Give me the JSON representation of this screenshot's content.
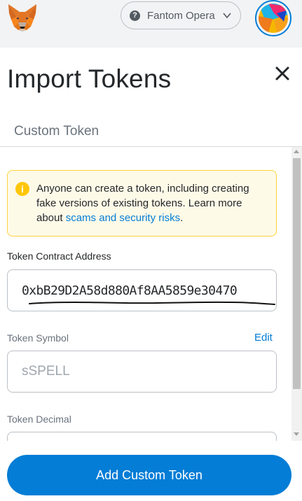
{
  "header": {
    "network_label": "Fantom Opera",
    "network_help_glyph": "?",
    "icons": {
      "logo": "metamask-fox-icon",
      "help": "question-circle-icon",
      "dropdown": "chevron-down-icon",
      "account": "account-avatar-icon",
      "close": "close-icon",
      "warning": "info-warning-icon"
    }
  },
  "page": {
    "title": "Import Tokens",
    "tab_custom_token": "Custom Token"
  },
  "warning": {
    "glyph": "i",
    "text_before_link": "Anyone can create a token, including creating fake versions of existing tokens. Learn more about ",
    "link_text": "scams and security risks",
    "text_after_link": "."
  },
  "form": {
    "contract_address": {
      "label": "Token Contract Address",
      "value": "0xbB29D2A58d880Af8AA5859e30470"
    },
    "token_symbol": {
      "label": "Token Symbol",
      "edit_label": "Edit",
      "value": "sSPELL"
    },
    "token_decimal": {
      "label": "Token Decimal"
    }
  },
  "footer": {
    "add_button_label": "Add Custom Token"
  },
  "colors": {
    "accent": "#037dd6",
    "warning_bg": "#fefae8",
    "warning_border": "#ffd33d",
    "warning_icon": "#ffc70a",
    "topbar_bg": "#f2f3f4"
  }
}
